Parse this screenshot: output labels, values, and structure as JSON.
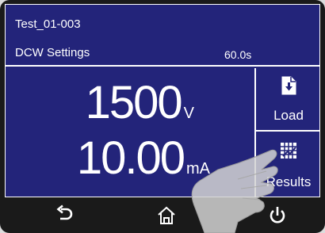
{
  "header": {
    "test_name": "Test_01-003",
    "settings_title": "DCW Settings",
    "time_readout": "60.0s"
  },
  "readouts": {
    "voltage_value": "1500",
    "voltage_unit": "V",
    "current_value": "10.00",
    "current_unit": "mA"
  },
  "side_panel": {
    "load_label": "Load",
    "load_icon": "load-file-icon",
    "results_label": "Results",
    "results_icon": "results-grid-icon"
  },
  "navbar": {
    "back_icon": "back-arrow-icon",
    "home_icon": "home-icon",
    "power_icon": "power-icon"
  },
  "colors": {
    "screen_background": "#23247a",
    "bezel": "#1a1a1a",
    "text": "#ffffff"
  }
}
